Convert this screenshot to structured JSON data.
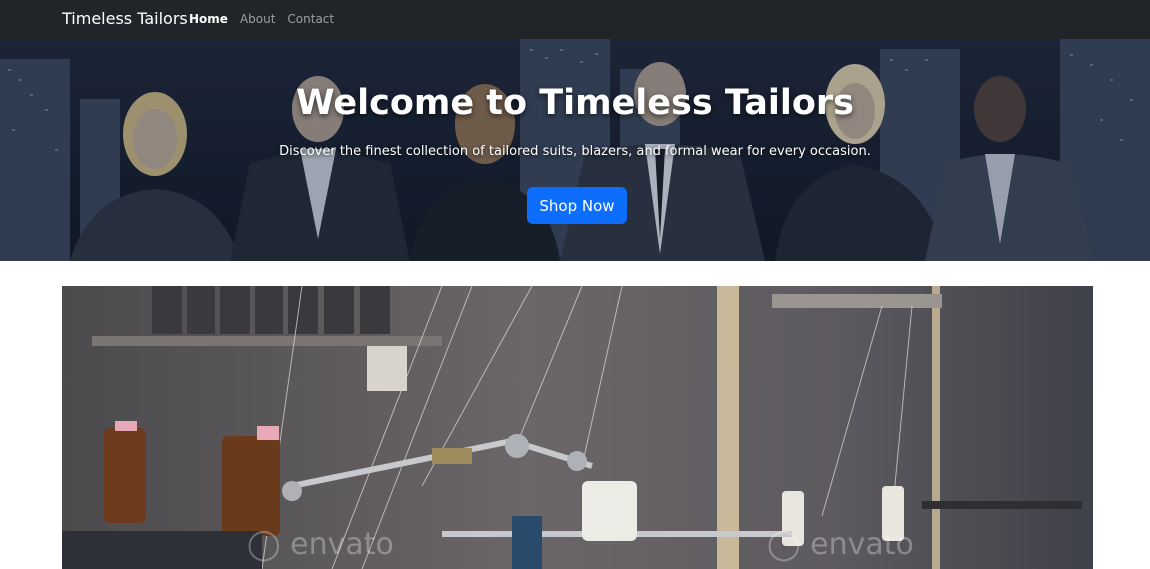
{
  "navbar": {
    "brand": "Timeless Tailors",
    "links": [
      {
        "label": "Home",
        "active": true
      },
      {
        "label": "About",
        "active": false
      },
      {
        "label": "Contact",
        "active": false
      }
    ]
  },
  "hero": {
    "title": "Welcome to Timeless Tailors",
    "subtitle": "Discover the finest collection of tailored suits, blazers, and formal wear for every occasion.",
    "cta_label": "Shop Now"
  },
  "workshop_image": {
    "watermark": "envato"
  },
  "colors": {
    "navbar_bg": "#212529",
    "primary": "#0d6efd"
  }
}
